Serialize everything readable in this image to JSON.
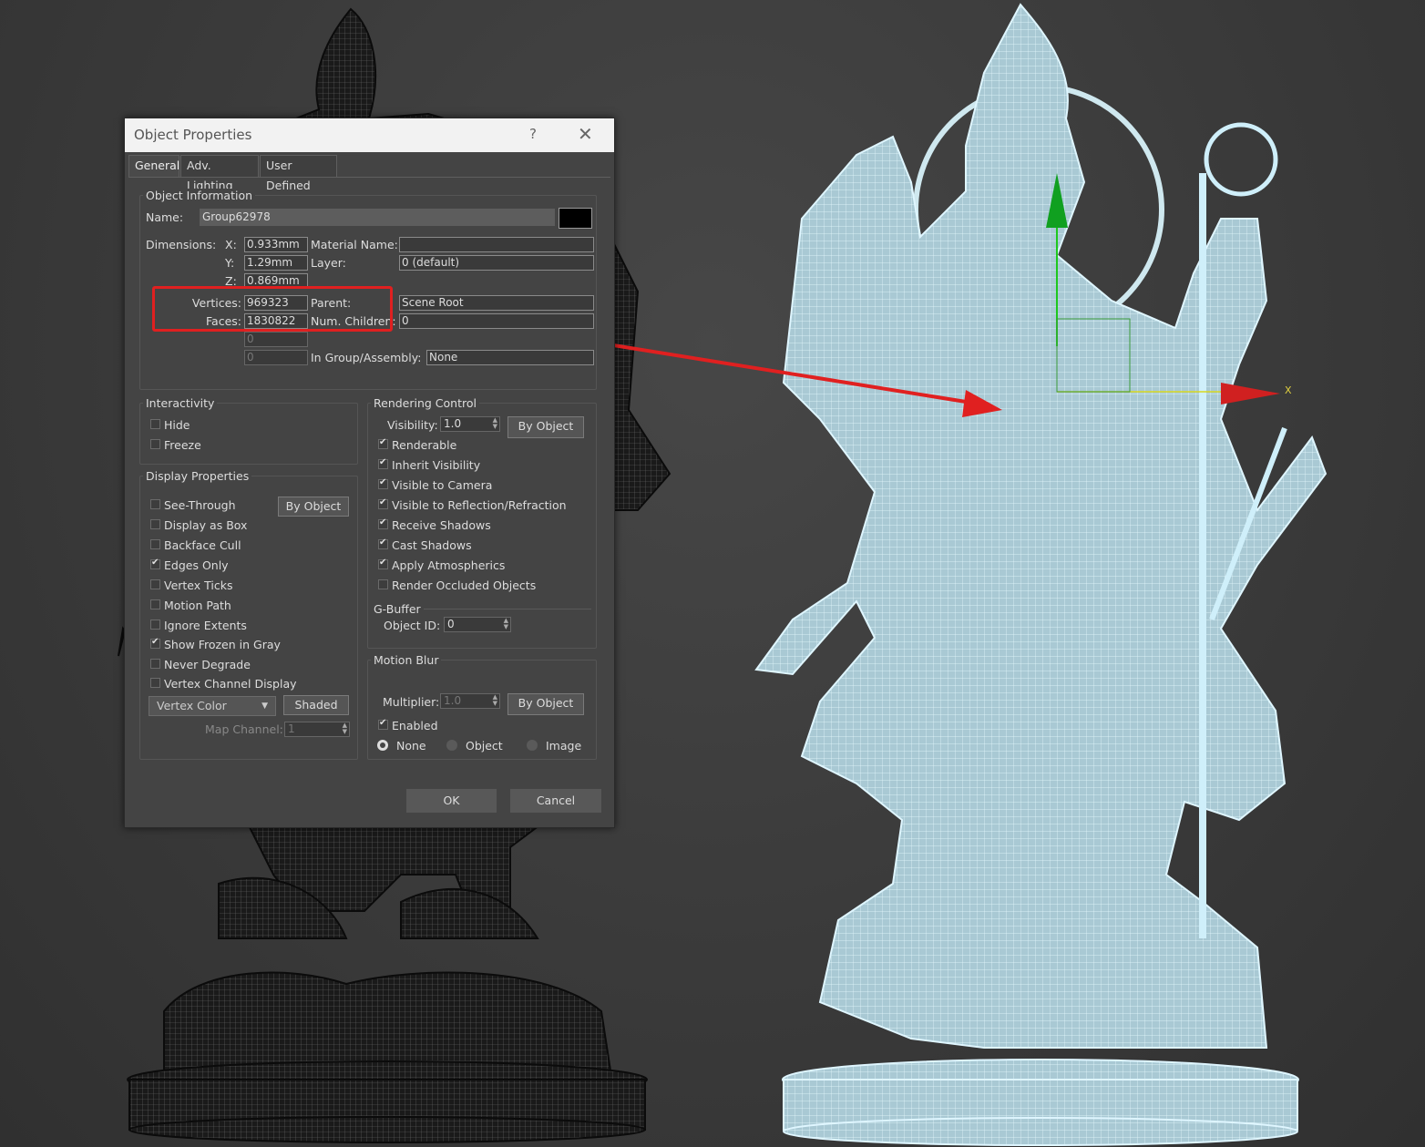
{
  "dialog": {
    "title": "Object Properties",
    "help": "?",
    "close": "✕",
    "tabs": [
      "General",
      "Adv. Lighting",
      "User Defined"
    ]
  },
  "object_info": {
    "group_title": "Object Information",
    "name_label": "Name:",
    "name_value": "Group62978",
    "color": "#000000",
    "dimensions_label": "Dimensions:",
    "x_label": "X:",
    "x_value": "0.933mm",
    "y_label": "Y:",
    "y_value": "1.29mm",
    "z_label": "Z:",
    "z_value": "0.869mm",
    "material_label": "Material Name:",
    "material_value": "",
    "layer_label": "Layer:",
    "layer_value": "0 (default)",
    "vertices_label": "Vertices:",
    "vertices_value": "969323",
    "faces_label": "Faces:",
    "faces_value": "1830822",
    "parent_label": "Parent:",
    "parent_value": "Scene Root",
    "children_label": "Num. Children:",
    "children_value": "0",
    "extra1_value": "0",
    "extra2_value": "0",
    "group_label": "In Group/Assembly:",
    "group_value": "None"
  },
  "interactivity": {
    "title": "Interactivity",
    "hide": {
      "label": "Hide",
      "checked": false
    },
    "freeze": {
      "label": "Freeze",
      "checked": false
    }
  },
  "display_properties": {
    "title": "Display Properties",
    "by_object": "By Object",
    "items": [
      {
        "label": "See-Through",
        "checked": false
      },
      {
        "label": "Display as Box",
        "checked": false
      },
      {
        "label": "Backface Cull",
        "checked": false
      },
      {
        "label": "Edges Only",
        "checked": true
      },
      {
        "label": "Vertex Ticks",
        "checked": false
      },
      {
        "label": "Motion Path",
        "checked": false
      },
      {
        "label": "Ignore Extents",
        "checked": false
      },
      {
        "label": "Show Frozen in Gray",
        "checked": true
      },
      {
        "label": "Never Degrade",
        "checked": false
      },
      {
        "label": "Vertex Channel Display",
        "checked": false
      }
    ],
    "vertex_color": "Vertex Color",
    "shaded": "Shaded",
    "map_channel_label": "Map Channel:",
    "map_channel_value": "1"
  },
  "rendering_control": {
    "title": "Rendering Control",
    "visibility_label": "Visibility:",
    "visibility_value": "1.0",
    "by_object": "By Object",
    "items": [
      {
        "label": "Renderable",
        "checked": true
      },
      {
        "label": "Inherit Visibility",
        "checked": true
      },
      {
        "label": "Visible to Camera",
        "checked": true
      },
      {
        "label": "Visible to Reflection/Refraction",
        "checked": true
      },
      {
        "label": "Receive Shadows",
        "checked": true
      },
      {
        "label": "Cast Shadows",
        "checked": true
      },
      {
        "label": "Apply Atmospherics",
        "checked": true
      },
      {
        "label": "Render Occluded Objects",
        "checked": false
      }
    ],
    "gbuffer_title": "G-Buffer",
    "object_id_label": "Object ID:",
    "object_id_value": "0"
  },
  "motion_blur": {
    "title": "Motion Blur",
    "multiplier_label": "Multiplier:",
    "multiplier_value": "1.0",
    "by_object": "By Object",
    "enabled_label": "Enabled",
    "enabled": true,
    "options": [
      "None",
      "Object",
      "Image"
    ],
    "selected": "None"
  },
  "footer": {
    "ok": "OK",
    "cancel": "Cancel"
  },
  "viewport": {
    "axis_label": "X"
  }
}
